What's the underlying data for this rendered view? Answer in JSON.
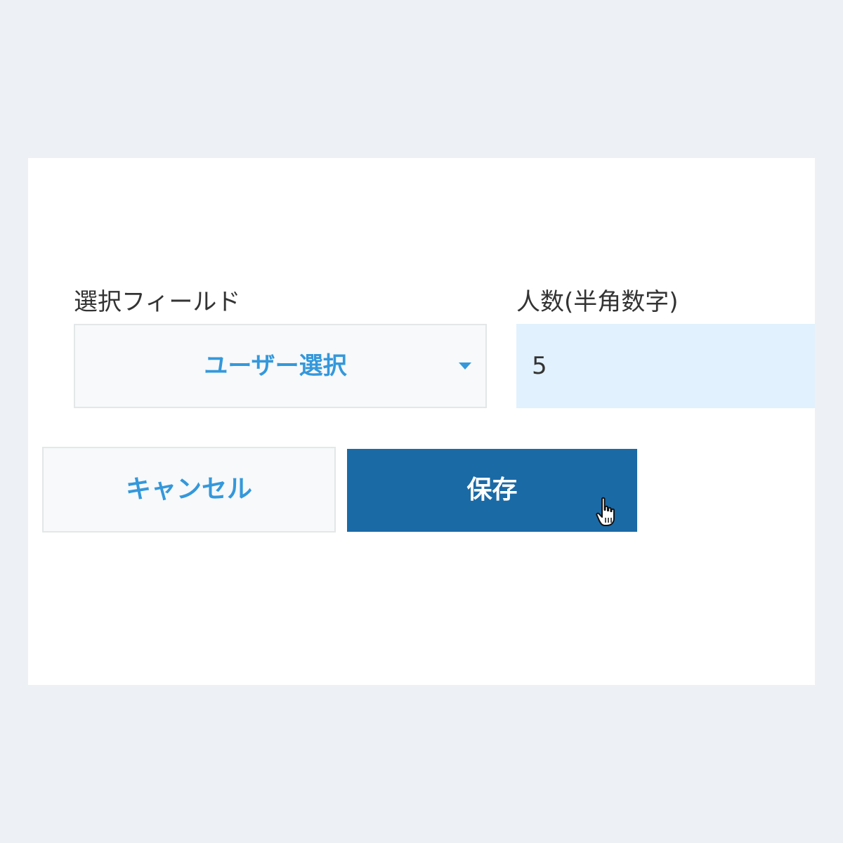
{
  "form": {
    "select_field": {
      "label": "選択フィールド",
      "value": "ユーザー選択"
    },
    "count_field": {
      "label": "人数(半角数字)",
      "value": "5"
    }
  },
  "buttons": {
    "cancel_label": "キャンセル",
    "save_label": "保存"
  },
  "colors": {
    "accent": "#3498db",
    "primary_button": "#1a6aa6",
    "input_background": "#e1f1fd",
    "page_background": "#edf1f6"
  },
  "icons": {
    "dropdown": "caret-down-icon",
    "pointer": "hand-pointer-cursor-icon"
  }
}
